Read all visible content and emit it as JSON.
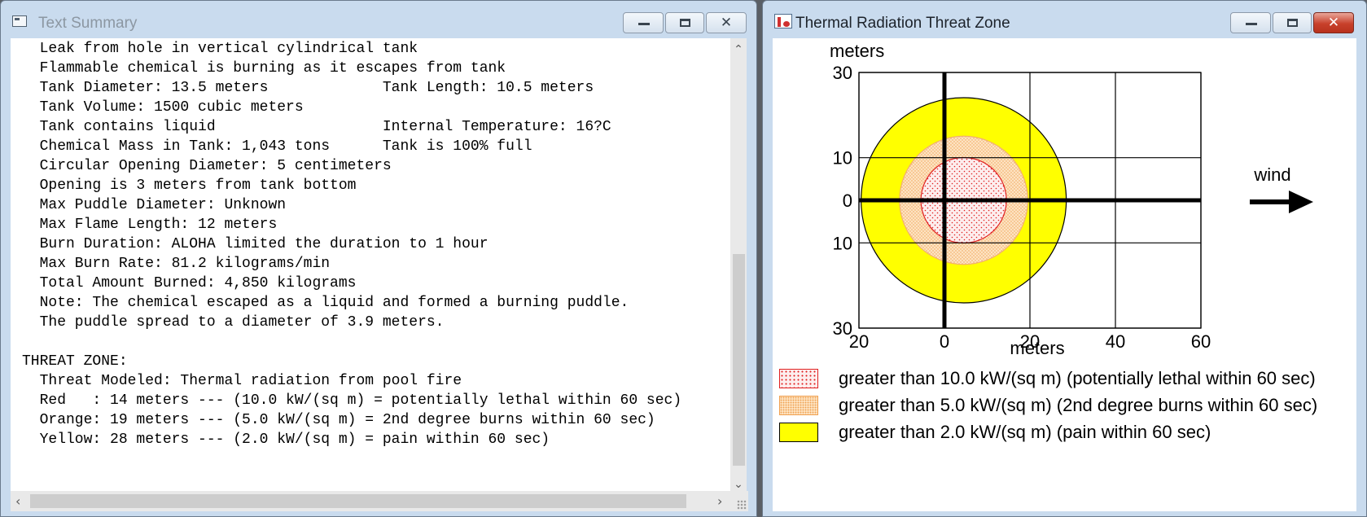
{
  "text_window": {
    "title": "Text Summary",
    "lines": [
      "  Leak from hole in vertical cylindrical tank",
      "  Flammable chemical is burning as it escapes from tank",
      "  Tank Diameter: 13.5 meters             Tank Length: 10.5 meters",
      "  Tank Volume: 1500 cubic meters",
      "  Tank contains liquid                   Internal Temperature: 16?C",
      "  Chemical Mass in Tank: 1,043 tons      Tank is 100% full",
      "  Circular Opening Diameter: 5 centimeters",
      "  Opening is 3 meters from tank bottom",
      "  Max Puddle Diameter: Unknown",
      "  Max Flame Length: 12 meters",
      "  Burn Duration: ALOHA limited the duration to 1 hour",
      "  Max Burn Rate: 81.2 kilograms/min",
      "  Total Amount Burned: 4,850 kilograms",
      "  Note: The chemical escaped as a liquid and formed a burning puddle.",
      "  The puddle spread to a diameter of 3.9 meters.",
      "",
      "THREAT ZONE:",
      "  Threat Modeled: Thermal radiation from pool fire",
      "  Red   : 14 meters --- (10.0 kW/(sq m) = potentially lethal within 60 sec)",
      "  Orange: 19 meters --- (5.0 kW/(sq m) = 2nd degree burns within 60 sec)",
      "  Yellow: 28 meters --- (2.0 kW/(sq m) = pain within 60 sec)"
    ]
  },
  "zone_window": {
    "title": "Thermal Radiation Threat Zone",
    "plot": {
      "y_axis_label": "meters",
      "x_axis_label": "meters",
      "x_ticks": [
        {
          "value": -20,
          "label": "20"
        },
        {
          "value": 0,
          "label": "0"
        },
        {
          "value": 20,
          "label": "20"
        },
        {
          "value": 40,
          "label": "40"
        },
        {
          "value": 60,
          "label": "60"
        }
      ],
      "y_ticks": [
        {
          "value": 30,
          "label": "30"
        },
        {
          "value": 10,
          "label": "10"
        },
        {
          "value": 0,
          "label": "0"
        },
        {
          "value": -10,
          "label": "10"
        },
        {
          "value": -30,
          "label": "30"
        }
      ],
      "x_range": [
        -20,
        60
      ],
      "y_range": [
        -30,
        30
      ],
      "wind_label": "wind",
      "zones": [
        {
          "name": "yellow",
          "center_x": 4.5,
          "center_y": 0,
          "radius": 24,
          "color": "#ffff00"
        },
        {
          "name": "orange",
          "center_x": 4.5,
          "center_y": 0,
          "radius": 15,
          "color": "#fde3c2"
        },
        {
          "name": "red",
          "center_x": 4.5,
          "center_y": 0,
          "radius": 10,
          "color": "#fdeeee"
        }
      ]
    },
    "legend": [
      {
        "label": "greater than 10.0 kW/(sq m) (potentially lethal within 60 sec)",
        "fill": "#fdeeee",
        "border": "#e02020",
        "pattern": "red-dots"
      },
      {
        "label": "greater than 5.0 kW/(sq m) (2nd degree burns within 60 sec)",
        "fill": "#fde3c2",
        "border": "#f0a050",
        "pattern": "orange-dots"
      },
      {
        "label": "greater than 2.0 kW/(sq m) (pain within 60 sec)",
        "fill": "#ffff00",
        "border": "#000000",
        "pattern": "solid"
      }
    ]
  }
}
